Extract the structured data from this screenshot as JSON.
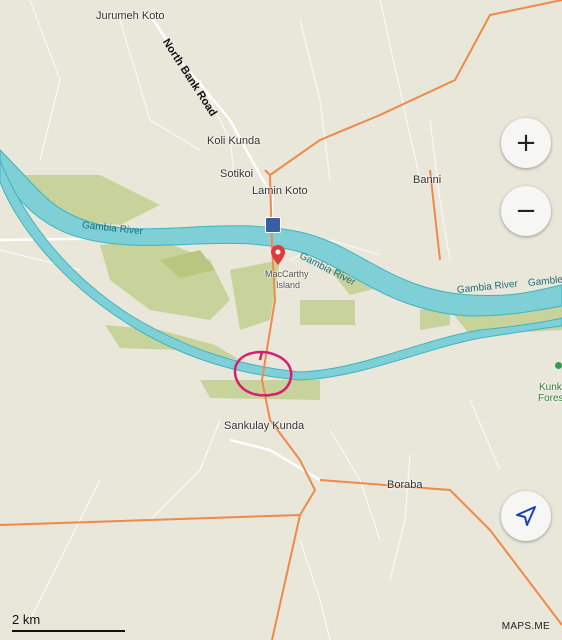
{
  "places": {
    "jurumeh_koto": "Jurumeh Koto",
    "koli_kunda": "Koli Kunda",
    "sotikoi": "Sotikoi",
    "lamin_koto": "Lamin Koto",
    "banni": "Banni",
    "maccarthy_line1": "MacCarthy",
    "maccarthy_line2": "Island",
    "sankulay_kunda": "Sankulay Kunda",
    "boraba": "Boraba",
    "kunk_line1": "Kunk",
    "kunk_line2": "Fores"
  },
  "rivers": {
    "left": "Gambia River",
    "middle": "Gambia River",
    "right": "Gambia River",
    "far_right": "Gamble"
  },
  "roads": {
    "north_bank": "North Bank Road"
  },
  "controls": {
    "zoom_in": "+",
    "zoom_out": "−",
    "my_location_icon": "navigation-arrow-icon"
  },
  "scale": {
    "label": "2 km"
  },
  "attribution": "MAPS.ME",
  "colors": {
    "background": "#e9e6da",
    "water": "#7fd0d6",
    "water_edge": "#3fb3c0",
    "vegetation": "#c8d39b",
    "road_primary": "#ee8a4a",
    "annotation": "#d4206f"
  }
}
